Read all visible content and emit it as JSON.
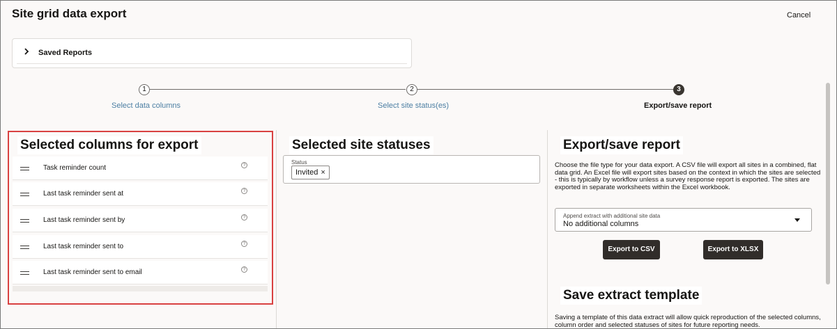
{
  "header": {
    "title": "Site grid data export",
    "cancel_label": "Cancel"
  },
  "saved_reports": {
    "label": "Saved Reports",
    "icon": "chevron-right-icon"
  },
  "steps": [
    {
      "number": "1",
      "label": "Select data columns",
      "state": "link"
    },
    {
      "number": "2",
      "label": "Select site status(es)",
      "state": "link"
    },
    {
      "number": "3",
      "label": "Export/save report",
      "state": "current"
    }
  ],
  "columns_panel": {
    "heading": "Selected columns for export",
    "rows": [
      {
        "label": "Task reminder count",
        "help": "?"
      },
      {
        "label": "Last task reminder sent at",
        "help": "?"
      },
      {
        "label": "Last task reminder sent by",
        "help": "?"
      },
      {
        "label": "Last task reminder sent to",
        "help": "?"
      },
      {
        "label": "Last task reminder sent to email",
        "help": "?"
      }
    ]
  },
  "statuses_panel": {
    "heading": "Selected site statuses",
    "field_label": "Status",
    "chips": [
      {
        "label": "Invited",
        "remove": "×"
      }
    ]
  },
  "export_panel": {
    "heading": "Export/save report",
    "description": "Choose the file type for your data export. A CSV file will export all sites in a combined, flat data grid. An Excel file will export sites based on the context in which the sites are selected - this is typically by workflow unless a survey response report is exported. The sites are exported in separate worksheets within the Excel workbook.",
    "append_label": "Append extract with additional site data",
    "append_value": "No additional columns",
    "csv_button": "Export to CSV",
    "xlsx_button": "Export to XLSX"
  },
  "template_panel": {
    "heading": "Save extract template",
    "description": "Saving a template of this data extract will allow quick reproduction of the selected columns, column order and selected statuses of sites for future reporting needs."
  },
  "colors": {
    "link": "#4c7fa3",
    "highlight_border": "#d94141",
    "button_bg": "#312d2a"
  }
}
